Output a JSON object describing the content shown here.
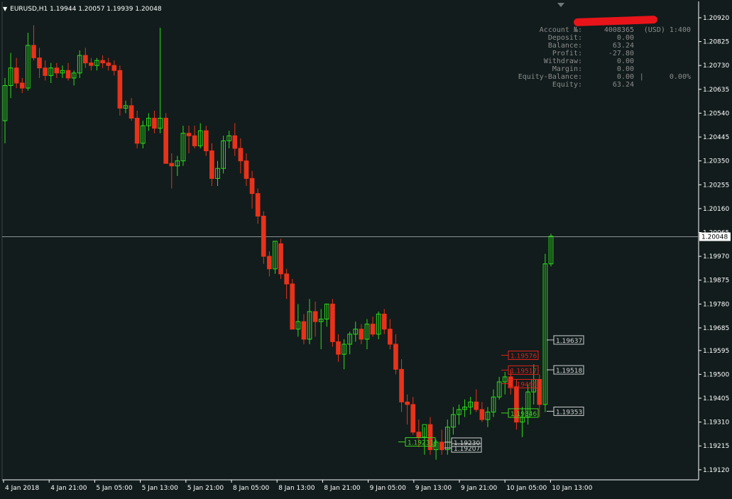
{
  "window": {
    "symbol_header": "EURUSD,H1  1.19944 1.20057 1.19939 1.20048"
  },
  "account": {
    "name_redacted": true,
    "rows": [
      {
        "label": "Account №:",
        "v1": "4008365",
        "v2": "(USD) 1:400"
      },
      {
        "label": "Deposit:",
        "v1": "0.00",
        "v2": ""
      },
      {
        "label": "Balance:",
        "v1": "63.24",
        "v2": ""
      },
      {
        "label": "Profit:",
        "v1": "-27.80",
        "v2": ""
      },
      {
        "label": "Withdraw:",
        "v1": "0.00",
        "v2": ""
      },
      {
        "label": "Margin:",
        "v1": "0.00",
        "v2": ""
      },
      {
        "label": "Equity-Balance:",
        "v1": "0.00",
        "v2": "|      0.00%"
      },
      {
        "label": "Equity:",
        "v1": "63.24",
        "v2": ""
      }
    ]
  },
  "chart_data": {
    "type": "candlestick",
    "symbol": "EURUSD",
    "timeframe": "H1",
    "ylim": [
      1.1908,
      1.20985
    ],
    "y_ticks": [
      "1.20920",
      "1.20825",
      "1.20730",
      "1.20635",
      "1.20540",
      "1.20445",
      "1.20350",
      "1.20255",
      "1.20160",
      "1.20065",
      "1.19970",
      "1.19875",
      "1.19780",
      "1.19685",
      "1.19595",
      "1.19500",
      "1.19405",
      "1.19310",
      "1.19215",
      "1.19120"
    ],
    "x_labels": [
      "4 Jan 2018",
      "4 Jan 21:00",
      "5 Jan 05:00",
      "5 Jan 13:00",
      "5 Jan 21:00",
      "8 Jan 05:00",
      "8 Jan 13:00",
      "8 Jan 21:00",
      "9 Jan 05:00",
      "9 Jan 13:00",
      "9 Jan 21:00",
      "10 Jan 05:00",
      "10 Jan 13:00"
    ],
    "current_price": "1.20048",
    "candles": [
      [
        1.2051,
        1.2068,
        1.2042,
        1.2065
      ],
      [
        1.2065,
        1.2078,
        1.206,
        1.2072
      ],
      [
        1.2072,
        1.2076,
        1.2064,
        1.2066
      ],
      [
        1.2066,
        1.2068,
        1.2062,
        1.2064
      ],
      [
        1.2064,
        1.2086,
        1.2063,
        1.2081
      ],
      [
        1.2081,
        1.2089,
        1.2075,
        1.2076
      ],
      [
        1.2076,
        1.208,
        1.2068,
        1.2072
      ],
      [
        1.2072,
        1.2075,
        1.2067,
        1.2069
      ],
      [
        1.2069,
        1.2074,
        1.2066,
        1.2072
      ],
      [
        1.2072,
        1.2074,
        1.2068,
        1.207
      ],
      [
        1.207,
        1.2073,
        1.2068,
        1.2071
      ],
      [
        1.2071,
        1.2074,
        1.2067,
        1.2068
      ],
      [
        1.2068,
        1.2071,
        1.2065,
        1.207
      ],
      [
        1.207,
        1.2079,
        1.2068,
        1.2077
      ],
      [
        1.2077,
        1.208,
        1.2072,
        1.2074
      ],
      [
        1.2074,
        1.2076,
        1.2071,
        1.2073
      ],
      [
        1.2073,
        1.2076,
        1.2071,
        1.2075
      ],
      [
        1.2075,
        1.2077,
        1.2072,
        1.2074
      ],
      [
        1.2074,
        1.2076,
        1.2071,
        1.2073
      ],
      [
        1.2073,
        1.2075,
        1.2069,
        1.2071
      ],
      [
        1.2071,
        1.2073,
        1.2053,
        1.2056
      ],
      [
        1.2056,
        1.2059,
        1.2054,
        1.2057
      ],
      [
        1.2057,
        1.206,
        1.2051,
        1.2052
      ],
      [
        1.2052,
        1.2055,
        1.204,
        1.2042
      ],
      [
        1.2042,
        1.2051,
        1.204,
        1.2049
      ],
      [
        1.2049,
        1.2054,
        1.2047,
        1.2052
      ],
      [
        1.2052,
        1.2055,
        1.2046,
        1.2048
      ],
      [
        1.2048,
        1.2088,
        1.2046,
        1.2052
      ],
      [
        1.2052,
        1.2054,
        1.204,
        1.2034
      ],
      [
        1.2034,
        1.2038,
        1.2024,
        1.2033
      ],
      [
        1.2033,
        1.2037,
        1.2029,
        1.2035
      ],
      [
        1.2035,
        1.2049,
        1.2033,
        1.2046
      ],
      [
        1.2046,
        1.2049,
        1.2038,
        1.2045
      ],
      [
        1.2045,
        1.2049,
        1.204,
        1.2041
      ],
      [
        1.2041,
        1.205,
        1.204,
        1.2047
      ],
      [
        1.2047,
        1.2049,
        1.2037,
        1.2039
      ],
      [
        1.2039,
        1.2042,
        1.2025,
        1.2028
      ],
      [
        1.2028,
        1.2035,
        1.2025,
        1.2032
      ],
      [
        1.2032,
        1.2045,
        1.203,
        1.2043
      ],
      [
        1.2043,
        1.2047,
        1.204,
        1.2045
      ],
      [
        1.2045,
        1.205,
        1.2037,
        1.204
      ],
      [
        1.204,
        1.2044,
        1.203,
        1.2035
      ],
      [
        1.2035,
        1.2038,
        1.2025,
        1.2028
      ],
      [
        1.2028,
        1.2031,
        1.2016,
        1.2022
      ],
      [
        1.2022,
        1.2024,
        1.201,
        1.2013
      ],
      [
        1.2013,
        1.2015,
        1.1994,
        1.1997
      ],
      [
        1.1997,
        1.1999,
        1.1989,
        1.1992
      ],
      [
        1.1992,
        1.2003,
        1.199,
        1.2003
      ],
      [
        1.2002,
        1.2004,
        1.1988,
        1.199
      ],
      [
        1.199,
        1.1992,
        1.198,
        1.1986
      ],
      [
        1.1986,
        1.1988,
        1.1973,
        1.1968
      ],
      [
        1.1968,
        1.1978,
        1.1965,
        1.1971
      ],
      [
        1.1971,
        1.1974,
        1.1962,
        1.1964
      ],
      [
        1.1964,
        1.198,
        1.1962,
        1.1975
      ],
      [
        1.1975,
        1.1979,
        1.1965,
        1.1971
      ],
      [
        1.1971,
        1.1976,
        1.196,
        1.1972
      ],
      [
        1.1972,
        1.1978,
        1.1969,
        1.1978
      ],
      [
        1.1978,
        1.198,
        1.1961,
        1.1963
      ],
      [
        1.1963,
        1.1966,
        1.1955,
        1.1958
      ],
      [
        1.1958,
        1.1964,
        1.1952,
        1.1962
      ],
      [
        1.1962,
        1.1967,
        1.1958,
        1.1966
      ],
      [
        1.1966,
        1.1971,
        1.1963,
        1.1968
      ],
      [
        1.1968,
        1.197,
        1.1962,
        1.1964
      ],
      [
        1.1964,
        1.1972,
        1.196,
        1.197
      ],
      [
        1.197,
        1.1973,
        1.1965,
        1.1966
      ],
      [
        1.1966,
        1.1975,
        1.1964,
        1.1974
      ],
      [
        1.1974,
        1.1976,
        1.1966,
        1.1968
      ],
      [
        1.1968,
        1.1972,
        1.196,
        1.1962
      ],
      [
        1.1962,
        1.1966,
        1.195,
        1.1952
      ],
      [
        1.1952,
        1.1956,
        1.1935,
        1.1939
      ],
      [
        1.1939,
        1.1942,
        1.193,
        1.1938
      ],
      [
        1.1938,
        1.1941,
        1.1926,
        1.1927
      ],
      [
        1.1927,
        1.1932,
        1.1921,
        1.1925
      ],
      [
        1.1925,
        1.1929,
        1.1918,
        1.193
      ],
      [
        1.193,
        1.1933,
        1.1918,
        1.192
      ],
      [
        1.192,
        1.1924,
        1.1916,
        1.1923
      ],
      [
        1.1923,
        1.1928,
        1.1918,
        1.192
      ],
      [
        1.192,
        1.1932,
        1.1918,
        1.1929
      ],
      [
        1.1929,
        1.1937,
        1.1926,
        1.1934
      ],
      [
        1.1934,
        1.1938,
        1.193,
        1.1936
      ],
      [
        1.1936,
        1.194,
        1.1933,
        1.1937
      ],
      [
        1.1937,
        1.1941,
        1.1934,
        1.1939
      ],
      [
        1.1939,
        1.1944,
        1.1935,
        1.1936
      ],
      [
        1.1936,
        1.1939,
        1.1931,
        1.1932
      ],
      [
        1.1932,
        1.1937,
        1.1929,
        1.1935
      ],
      [
        1.1935,
        1.1944,
        1.1933,
        1.1941
      ],
      [
        1.1941,
        1.1949,
        1.194,
        1.1947
      ],
      [
        1.1947,
        1.1951,
        1.1942,
        1.1949
      ],
      [
        1.1949,
        1.1952,
        1.1942,
        1.1945
      ],
      [
        1.1945,
        1.1948,
        1.1928,
        1.1931
      ],
      [
        1.1931,
        1.1937,
        1.1925,
        1.1933
      ],
      [
        1.1933,
        1.1946,
        1.193,
        1.1943
      ],
      [
        1.1943,
        1.1954,
        1.1938,
        1.1948
      ],
      [
        1.1948,
        1.195,
        1.1933,
        1.1938
      ],
      [
        1.1938,
        1.1998,
        1.1935,
        1.1994
      ],
      [
        1.1994,
        1.2006,
        1.1993,
        1.2005
      ]
    ],
    "annotations": [
      {
        "label": "1.19637",
        "price": 1.19637,
        "color": "#d0d0d0"
      },
      {
        "label": "1.19576",
        "price": 1.19576,
        "color": "#e0201a"
      },
      {
        "label": "1.19517",
        "price": 1.19517,
        "color": "#e0201a"
      },
      {
        "label": "1.19518",
        "price": 1.19518,
        "color": "#d0d0d0"
      },
      {
        "label": "1.19463",
        "price": 1.19463,
        "color": "#e0201a"
      },
      {
        "label": "1.19346",
        "price": 1.19346,
        "color": "#3cd61f"
      },
      {
        "label": "1.19353",
        "price": 1.19353,
        "color": "#d0d0d0"
      },
      {
        "label": "1.19231",
        "price": 1.19231,
        "color": "#3cd61f"
      },
      {
        "label": "1.19230",
        "price": 1.1923,
        "color": "#d0d0d0"
      },
      {
        "label": "1.19207",
        "price": 1.19207,
        "color": "#d0d0d0"
      }
    ]
  },
  "colors": {
    "background": "#121c1c",
    "bull": "#2ddc1e",
    "bear": "#e8321a",
    "axis": "#ffffff",
    "text": "#ffffff",
    "current_line": "#8a9090"
  }
}
